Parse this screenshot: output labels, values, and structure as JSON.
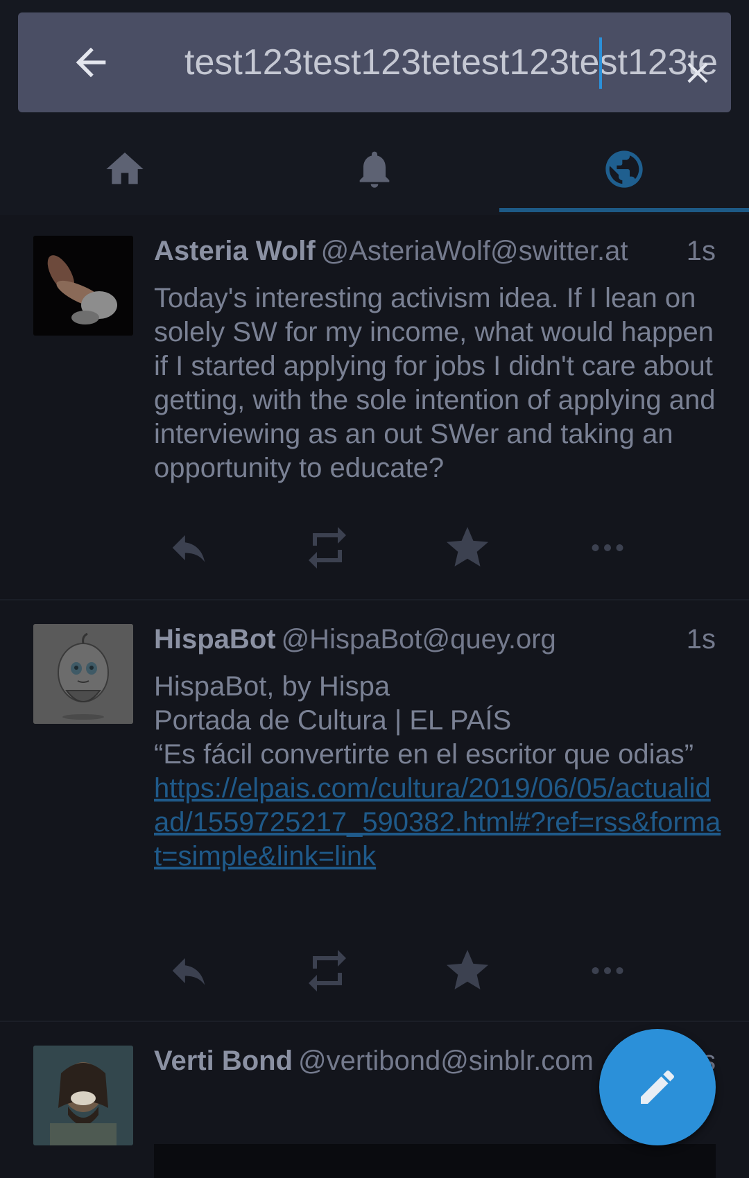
{
  "search": {
    "value": "test123test123tetest123test123te"
  },
  "tabs": [
    {
      "icon": "home-icon"
    },
    {
      "icon": "bell-icon"
    },
    {
      "icon": "globe-icon",
      "active": true
    }
  ],
  "statuses": [
    {
      "display_name": "Asteria Wolf",
      "acct": "@AsteriaWolf@switter.at",
      "time": "1s",
      "content": "Today's interesting activism idea. If I lean on solely SW for my income, what would happen if I started applying for jobs I didn't care about getting, with the sole intention of applying and interviewing as an out SWer and taking an opportunity to educate?"
    },
    {
      "display_name": "HispaBot",
      "acct": "@HispaBot@quey.org",
      "time": "1s",
      "content_lines": [
        "HispaBot, by Hispa",
        "Portada de Cultura | EL PAÍS",
        "“Es fácil convertirte en el escritor que odias”"
      ],
      "link": "https://elpais.com/cultura/2019/06/05/actualidad/1559725217_590382.html#?ref=rss&format=simple&link=link"
    },
    {
      "display_name": "Verti  Bond",
      "acct": "@vertibond@sinblr.com",
      "time": "1s"
    }
  ],
  "colors": {
    "accent": "#2b90d9",
    "background": "#13151c",
    "search_bar": "#4a4e64"
  }
}
